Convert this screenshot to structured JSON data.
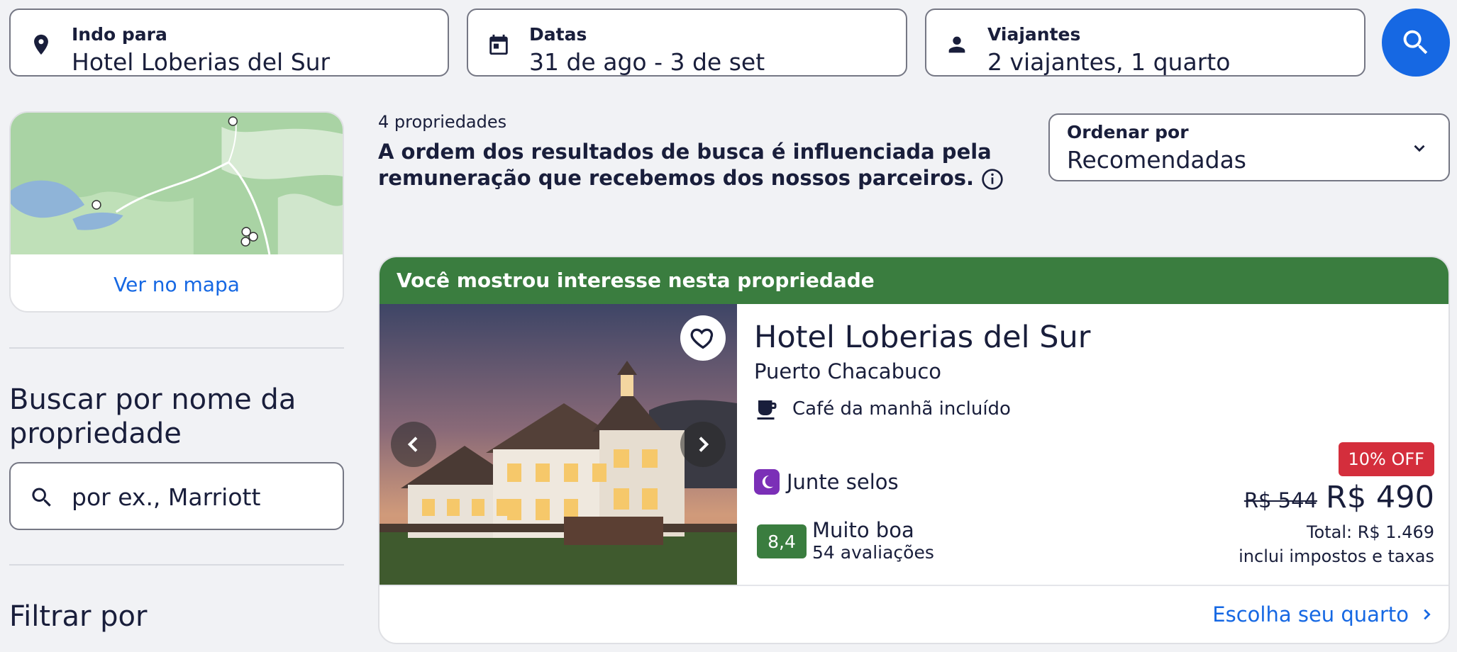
{
  "search": {
    "destination": {
      "label": "Indo para",
      "value": "Hotel Loberias del Sur"
    },
    "dates": {
      "label": "Datas",
      "value": "31 de ago - 3 de set"
    },
    "travelers": {
      "label": "Viajantes",
      "value": "2 viajantes, 1 quarto"
    }
  },
  "sidebar": {
    "map_link": "Ver no mapa",
    "name_search_heading": "Buscar por nome da propriedade",
    "name_search_placeholder": "por ex., Marriott",
    "filter_heading": "Filtrar por"
  },
  "results": {
    "count": "4 propriedades",
    "notice": "A ordem dos resultados de busca é influenciada pela remuneração que recebemos dos nossos parceiros.",
    "sort": {
      "label": "Ordenar por",
      "value": "Recomendadas"
    }
  },
  "listing": {
    "banner": "Você mostrou interesse nesta propriedade",
    "name": "Hotel Loberias del Sur",
    "location": "Puerto Chacabuco",
    "amenity": "Café da manhã incluído",
    "stamps": "Junte selos",
    "score": "8,4",
    "score_label": "Muito boa",
    "review_count": "54 avaliações",
    "discount_badge": "10% OFF",
    "old_price": "R$ 544",
    "price": "R$ 490",
    "total": "Total: R$ 1.469",
    "taxes_note": "inclui impostos e taxas",
    "cta": "Escolha seu quarto"
  },
  "colors": {
    "accent": "#1668e3",
    "banner_green": "#3a7d3f",
    "discount_red": "#d42e3c",
    "stamp_purple": "#7b2fb7"
  }
}
